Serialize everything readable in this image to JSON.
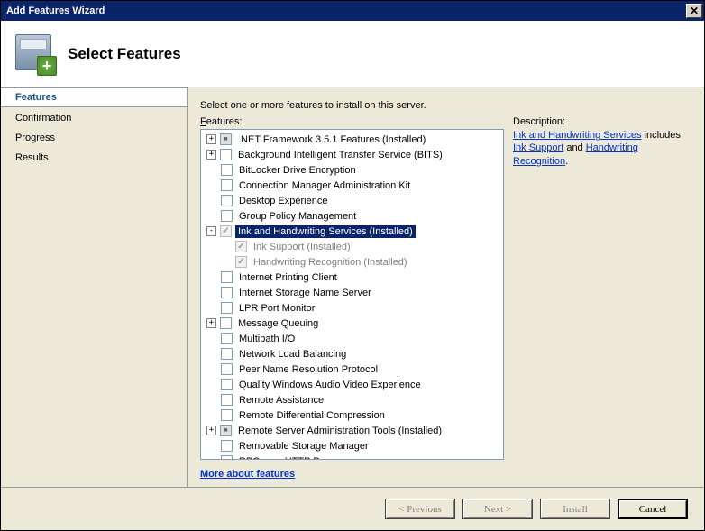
{
  "window": {
    "title": "Add Features Wizard"
  },
  "header": {
    "title": "Select Features"
  },
  "sidebar": {
    "items": [
      {
        "label": "Features",
        "active": true
      },
      {
        "label": "Confirmation",
        "active": false
      },
      {
        "label": "Progress",
        "active": false
      },
      {
        "label": "Results",
        "active": false
      }
    ]
  },
  "main": {
    "instruction": "Select one or more features to install on this server.",
    "features_label_pre": "F",
    "features_label_post": "eatures:",
    "description_label": "Description:",
    "description_parts": {
      "link1": "Ink and Handwriting Services",
      "mid1": " includes ",
      "link2": "Ink Support",
      "mid2": " and ",
      "link3": "Handwriting Recognition",
      "end": "."
    },
    "more_link": "More about features"
  },
  "tree": [
    {
      "depth": 0,
      "expander": "+",
      "cb": "mixed",
      "label": ".NET Framework 3.5.1 Features  (Installed)"
    },
    {
      "depth": 0,
      "expander": "+",
      "cb": "unchecked",
      "label": "Background Intelligent Transfer Service (BITS)"
    },
    {
      "depth": 0,
      "expander": "",
      "cb": "unchecked",
      "label": "BitLocker Drive Encryption"
    },
    {
      "depth": 0,
      "expander": "",
      "cb": "unchecked",
      "label": "Connection Manager Administration Kit"
    },
    {
      "depth": 0,
      "expander": "",
      "cb": "unchecked",
      "label": "Desktop Experience"
    },
    {
      "depth": 0,
      "expander": "",
      "cb": "unchecked",
      "label": "Group Policy Management"
    },
    {
      "depth": 0,
      "expander": "-",
      "cb": "checked-disabled",
      "label": "Ink and Handwriting Services  (Installed)",
      "selected": true
    },
    {
      "depth": 1,
      "expander": "",
      "cb": "checked-disabled",
      "label": "Ink Support  (Installed)",
      "dim": true
    },
    {
      "depth": 1,
      "expander": "",
      "cb": "checked-disabled",
      "label": "Handwriting Recognition  (Installed)",
      "dim": true
    },
    {
      "depth": 0,
      "expander": "",
      "cb": "unchecked",
      "label": "Internet Printing Client"
    },
    {
      "depth": 0,
      "expander": "",
      "cb": "unchecked",
      "label": "Internet Storage Name Server"
    },
    {
      "depth": 0,
      "expander": "",
      "cb": "unchecked",
      "label": "LPR Port Monitor"
    },
    {
      "depth": 0,
      "expander": "+",
      "cb": "unchecked",
      "label": "Message Queuing"
    },
    {
      "depth": 0,
      "expander": "",
      "cb": "unchecked",
      "label": "Multipath I/O"
    },
    {
      "depth": 0,
      "expander": "",
      "cb": "unchecked",
      "label": "Network Load Balancing"
    },
    {
      "depth": 0,
      "expander": "",
      "cb": "unchecked",
      "label": "Peer Name Resolution Protocol"
    },
    {
      "depth": 0,
      "expander": "",
      "cb": "unchecked",
      "label": "Quality Windows Audio Video Experience"
    },
    {
      "depth": 0,
      "expander": "",
      "cb": "unchecked",
      "label": "Remote Assistance"
    },
    {
      "depth": 0,
      "expander": "",
      "cb": "unchecked",
      "label": "Remote Differential Compression"
    },
    {
      "depth": 0,
      "expander": "+",
      "cb": "mixed",
      "label": "Remote Server Administration Tools  (Installed)"
    },
    {
      "depth": 0,
      "expander": "",
      "cb": "unchecked",
      "label": "Removable Storage Manager"
    },
    {
      "depth": 0,
      "expander": "",
      "cb": "unchecked",
      "label": "RPC over HTTP Proxy"
    }
  ],
  "footer": {
    "previous": "< Previous",
    "next": "Next >",
    "install": "Install",
    "cancel": "Cancel"
  }
}
